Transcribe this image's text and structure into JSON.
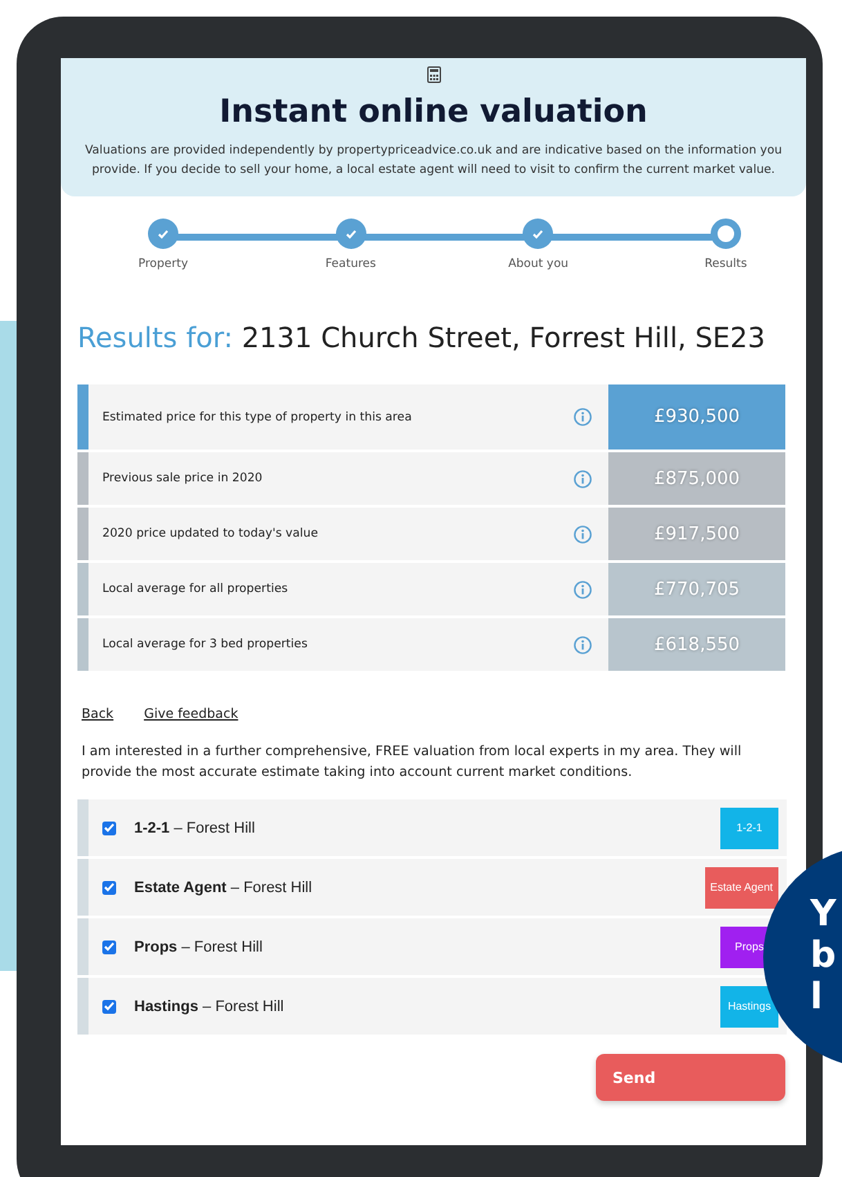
{
  "header": {
    "title": "Instant online valuation",
    "description": "Valuations are provided independently by propertypriceadvice.co.uk and are indicative based on the information you provide. If you decide to sell your home, a local estate agent will need to visit to confirm the current market value."
  },
  "steps": [
    {
      "label": "Property",
      "completed": true
    },
    {
      "label": "Features",
      "completed": true
    },
    {
      "label": "About you",
      "completed": true
    },
    {
      "label": "Results",
      "completed": false
    }
  ],
  "results": {
    "prefix": "Results for:",
    "address": "2131 Church Street, Forrest Hill, SE23"
  },
  "price_rows": [
    {
      "label": "Estimated price for this type of property in this area",
      "value": "£930,500",
      "color": "#5aa1d3"
    },
    {
      "label": "Previous sale price in 2020",
      "value": "£875,000",
      "color": "#b7bdc3"
    },
    {
      "label": "2020 price updated to today's value",
      "value": "£917,500",
      "color": "#b7bdc3"
    },
    {
      "label": "Local average for all properties",
      "value": "£770,705",
      "color": "#b8c5cd"
    },
    {
      "label": "Local average for 3 bed properties",
      "value": "£618,550",
      "color": "#b8c5cd"
    }
  ],
  "links": [
    "Back",
    "Give feedback"
  ],
  "interest_text": "I am interested in a further comprehensive, FREE valuation from local experts in my area. They will provide the most accurate estimate taking into account current market conditions.",
  "agents": [
    {
      "name": "1-2-1",
      "area": "– Forest Hill",
      "checked": true,
      "logo_text": "1-2-1",
      "color": "#12b4e8"
    },
    {
      "name": "Estate Agent",
      "area": "– Forest Hill",
      "checked": true,
      "logo_text": "Estate Agent",
      "color": "#e85c5c"
    },
    {
      "name": "Props",
      "area": "– Forest Hill",
      "checked": true,
      "logo_text": "Props",
      "color": "#a020f0"
    },
    {
      "name": "Hastings",
      "area": "– Forest Hill",
      "checked": true,
      "logo_text": "Hastings",
      "color": "#12b4e8"
    }
  ],
  "send_button": "Send",
  "badge_letters": [
    "Y",
    "b",
    "l"
  ]
}
